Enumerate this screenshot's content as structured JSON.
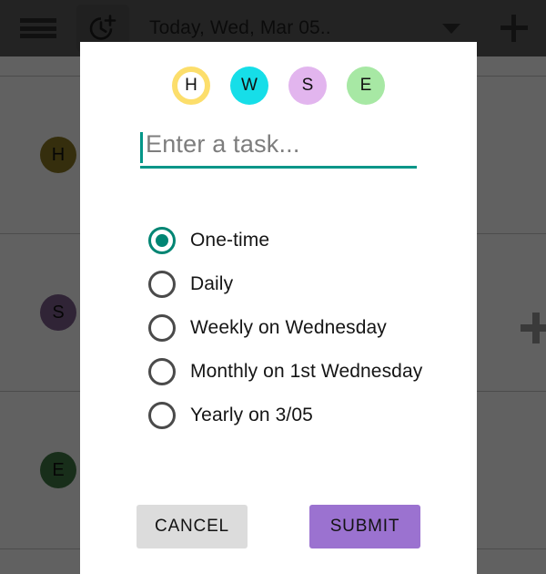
{
  "appbar": {
    "menu_icon": "hamburger-menu-icon",
    "timer_icon": "add-timer-icon",
    "title": "Today, Wed, Mar 05..",
    "dropdown_icon": "caret-down-icon",
    "add_icon": "plus-icon"
  },
  "background_list": {
    "rows": [
      {
        "avatar": "H",
        "avatar_color": "#8C7A22",
        "action": "remove",
        "action_icon": "minus-icon"
      },
      {
        "avatar": "S",
        "avatar_color": "#7E5F8E",
        "action": "add",
        "action_icon": "plus-icon"
      },
      {
        "avatar": "E",
        "avatar_color": "#3F7A45",
        "action": "remove",
        "action_icon": "minus-icon"
      }
    ]
  },
  "dialog": {
    "avatars": [
      {
        "letter": "H",
        "color": "#FCDE6B",
        "selected": true
      },
      {
        "letter": "W",
        "color": "#16DEE8",
        "selected": false
      },
      {
        "letter": "S",
        "color": "#E2B5EE",
        "selected": false
      },
      {
        "letter": "E",
        "color": "#A7E8A4",
        "selected": false
      }
    ],
    "task_input": {
      "value": "",
      "placeholder": "Enter a task...",
      "accent_color": "#009688"
    },
    "recurrence": {
      "selected_index": 0,
      "accent_color": "#008573",
      "options": [
        {
          "label": "One-time"
        },
        {
          "label": "Daily"
        },
        {
          "label": "Weekly on Wednesday"
        },
        {
          "label": "Monthly on 1st Wednesday"
        },
        {
          "label": "Yearly on 3/05"
        }
      ]
    },
    "buttons": {
      "cancel_label": "CANCEL",
      "cancel_color": "#dcdcdc",
      "submit_label": "SUBMIT",
      "submit_color": "#9B72D0"
    }
  }
}
